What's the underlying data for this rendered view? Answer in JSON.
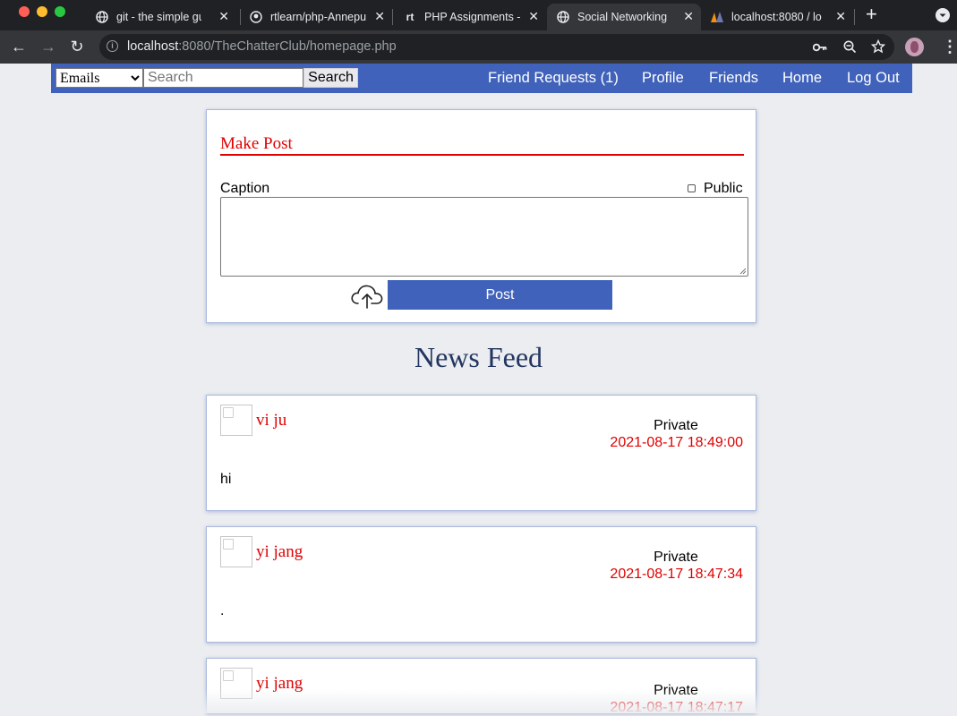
{
  "browser": {
    "tabs": [
      {
        "title": "git - the simple guide",
        "icon": "globe-icon"
      },
      {
        "title": "rtlearn/php-Annepu",
        "icon": "github-icon"
      },
      {
        "title": "PHP Assignments -",
        "icon": "rt-icon"
      },
      {
        "title": "Social Networking",
        "icon": "globe-icon"
      },
      {
        "title": "localhost:8080 / lo",
        "icon": "phpmyadmin-icon"
      }
    ],
    "url_host": "localhost",
    "url_rest": ":8080/TheChatterClub/homepage.php"
  },
  "navbar": {
    "select_value": "Emails",
    "search_placeholder": "Search",
    "search_button": "Search",
    "links": [
      "Friend Requests (1)",
      "Profile",
      "Friends",
      "Home",
      "Log Out"
    ]
  },
  "make_post": {
    "title": "Make Post",
    "caption_label": "Caption",
    "public_label": "Public",
    "post_button": "Post"
  },
  "news_feed": {
    "title": "News Feed",
    "posts": [
      {
        "author": "vi ju",
        "privacy": "Private",
        "timestamp": "2021-08-17 18:49:00",
        "body": "hi"
      },
      {
        "author": "yi jang",
        "privacy": "Private",
        "timestamp": "2021-08-17 18:47:34",
        "body": "."
      },
      {
        "author": "yi jang",
        "privacy": "Private",
        "timestamp": "2021-08-17 18:47:17",
        "body": ""
      }
    ]
  },
  "colors": {
    "nav": "#4062bb",
    "accent_red": "#e00000",
    "heading": "#233661"
  }
}
